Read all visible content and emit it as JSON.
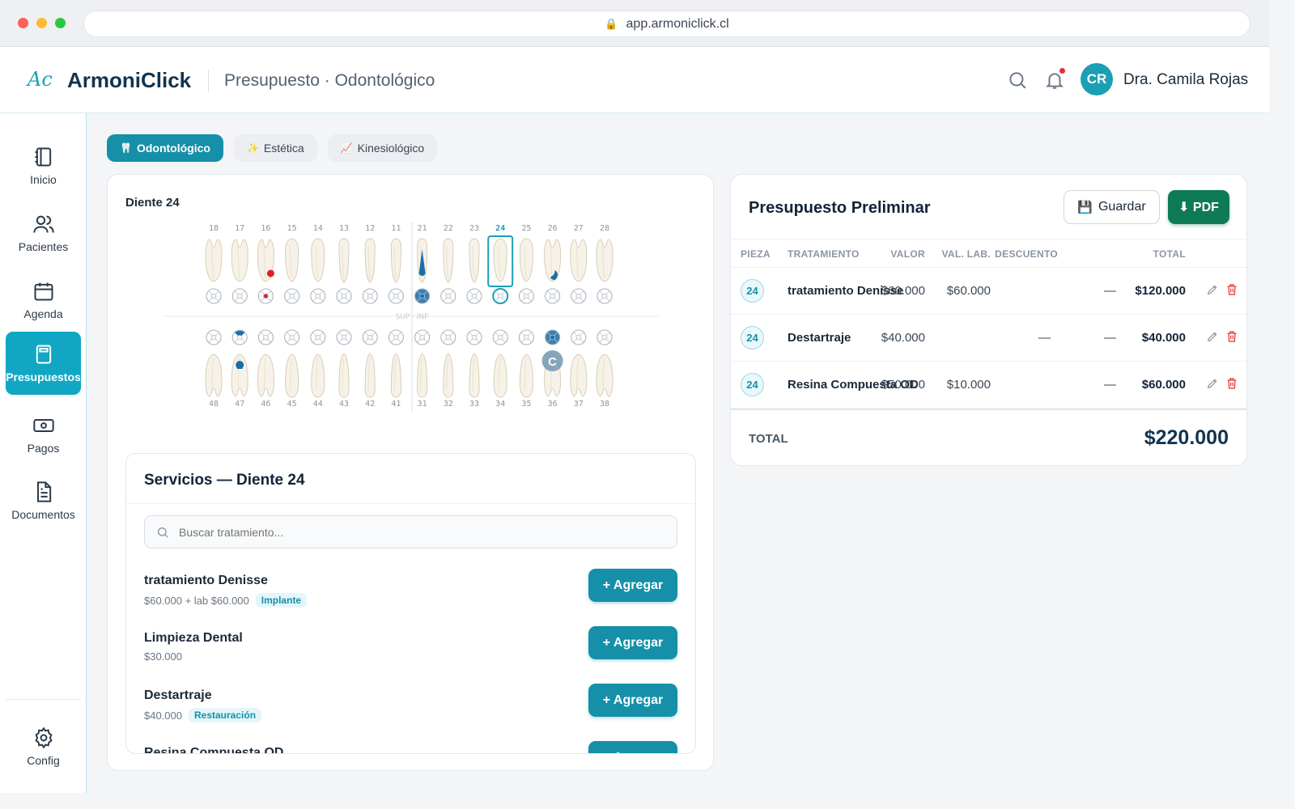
{
  "browser": {
    "url": "app.armoniclick.cl"
  },
  "header": {
    "logo_mark": "Ac",
    "app_name": "ArmoniClick",
    "page_title": "Presupuesto · Odontológico",
    "user_initials": "CR",
    "user_name": "Dra. Camila Rojas"
  },
  "sidebar": {
    "items": [
      {
        "label": "Inicio",
        "icon": "notebook-icon"
      },
      {
        "label": "Pacientes",
        "icon": "users-icon"
      },
      {
        "label": "Agenda",
        "icon": "calendar-icon"
      },
      {
        "label": "Presupuestos",
        "icon": "calculator-icon",
        "active": true
      },
      {
        "label": "Pagos",
        "icon": "banknote-icon"
      },
      {
        "label": "Documentos",
        "icon": "document-icon"
      }
    ],
    "config_label": "Config"
  },
  "tabs": [
    {
      "label": "Odontológico",
      "icon": "🦷",
      "active": true
    },
    {
      "label": "Estética",
      "icon": "✨"
    },
    {
      "label": "Kinesiológico",
      "icon": "📈"
    }
  ],
  "odontogram": {
    "title": "Diente 24",
    "upper_numbers": [
      "18",
      "17",
      "16",
      "15",
      "14",
      "13",
      "12",
      "11",
      "21",
      "22",
      "23",
      "24",
      "25",
      "26",
      "27",
      "28"
    ],
    "lower_numbers": [
      "48",
      "47",
      "46",
      "45",
      "44",
      "43",
      "42",
      "41",
      "31",
      "32",
      "33",
      "34",
      "35",
      "36",
      "37",
      "38"
    ],
    "divider_label": "SUP · INF",
    "selected_tooth": "24",
    "crown_marker": "C"
  },
  "services": {
    "title": "Servicios — Diente 24",
    "search_placeholder": "Buscar tratamiento...",
    "add_label": "+ Agregar",
    "items": [
      {
        "name": "tratamiento Denisse",
        "price": "$60.000 + lab $60.000",
        "badge": "Implante"
      },
      {
        "name": "Limpieza Dental",
        "price": "$30.000",
        "badge": ""
      },
      {
        "name": "Destartraje",
        "price": "$40.000",
        "badge": "Restauración"
      },
      {
        "name": "Resina Compuesta OD",
        "price": "",
        "badge": ""
      }
    ]
  },
  "budget": {
    "title": "Presupuesto Preliminar",
    "save_label": "Guardar",
    "pdf_label": "⬇ PDF",
    "columns": {
      "pieza": "PIEZA",
      "tratamiento": "TRATAMIENTO",
      "valor": "VALOR",
      "val_lab": "VAL. LAB.",
      "descuento": "DESCUENTO",
      "total": "TOTAL"
    },
    "rows": [
      {
        "pieza": "24",
        "tratamiento": "tratamiento Denisse",
        "valor": "$60.000",
        "val_lab": "$60.000",
        "descuento": "—",
        "total": "$120.000"
      },
      {
        "pieza": "24",
        "tratamiento": "Destartraje",
        "valor": "$40.000",
        "val_lab": "—",
        "descuento": "—",
        "total": "$40.000"
      },
      {
        "pieza": "24",
        "tratamiento": "Resina Compuesta OD",
        "valor": "$50.000",
        "val_lab": "$10.000",
        "descuento": "—",
        "total": "$60.000"
      }
    ],
    "total_label": "TOTAL",
    "total_value": "$220.000"
  },
  "colors": {
    "accent": "#1590a8",
    "accent_light": "#11a7c4",
    "pdf_green": "#0f7a56",
    "delete_red": "#e03131",
    "caries_red": "#e02020",
    "treatment_blue": "#1a6fa8"
  }
}
